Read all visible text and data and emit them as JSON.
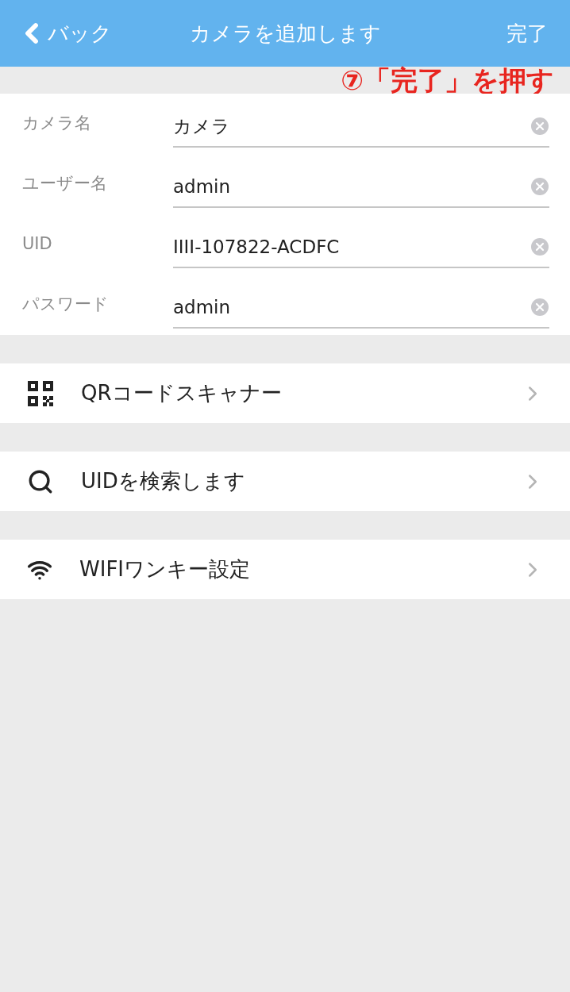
{
  "nav": {
    "back": "バック",
    "title": "カメラを追加します",
    "done": "完了"
  },
  "annotation": "⑦「完了」を押す",
  "fields": [
    {
      "label": "カメラ名",
      "value": "カメラ"
    },
    {
      "label": "ユーザー名",
      "value": "admin"
    },
    {
      "label": "UID",
      "value": "IIII-107822-ACDFC"
    },
    {
      "label": "パスワード",
      "value": "admin"
    }
  ],
  "menu": [
    {
      "kind": "qr",
      "label": "QRコードスキャナー"
    },
    {
      "kind": "search",
      "label": "UIDを検索します"
    },
    {
      "kind": "wifi",
      "label": "WIFIワンキー設定"
    }
  ]
}
